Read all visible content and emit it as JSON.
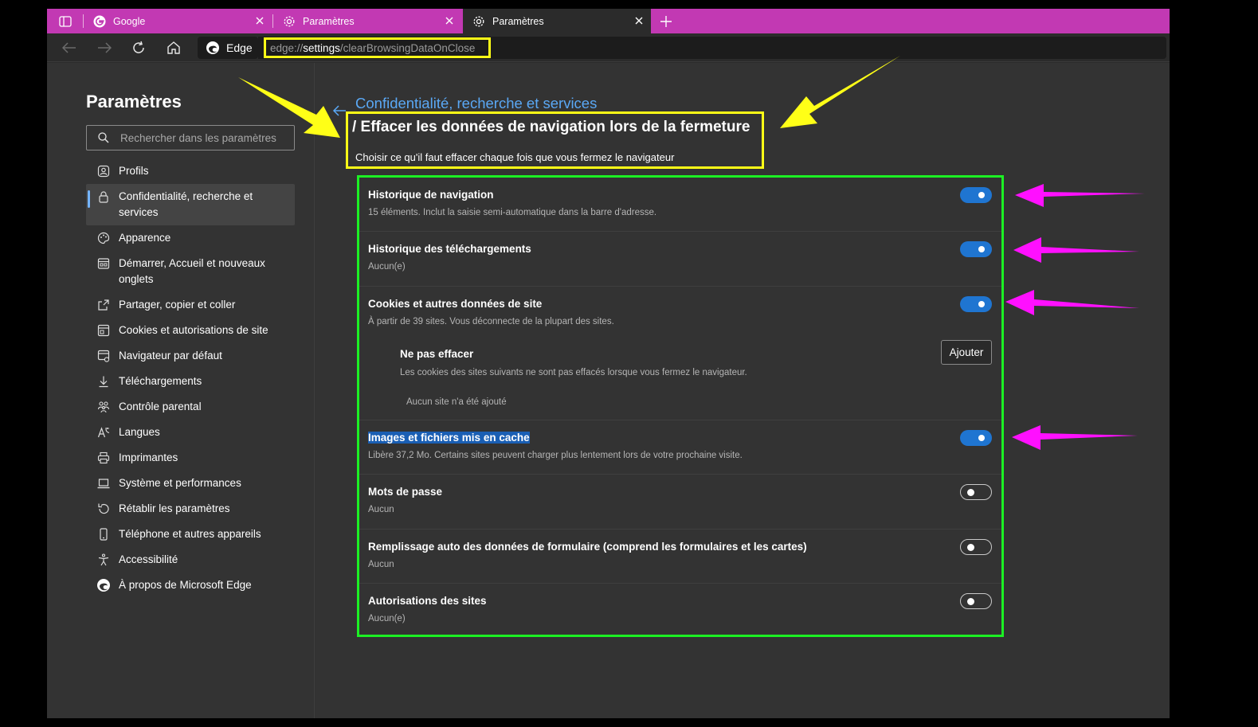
{
  "tabs": [
    {
      "title": "Google",
      "icon": "google-icon"
    },
    {
      "title": "Paramètres",
      "icon": "gear-icon"
    },
    {
      "title": "Paramètres",
      "icon": "gear-icon",
      "active": true
    }
  ],
  "toolbar": {
    "edge_label": "Edge",
    "url_scheme": "edge://",
    "url_host": "settings",
    "url_path": "/clearBrowsingDataOnClose"
  },
  "sidebar": {
    "title": "Paramètres",
    "search_placeholder": "Rechercher dans les paramètres",
    "items": [
      {
        "label": "Profils",
        "icon": "profile-icon"
      },
      {
        "label": "Confidentialité, recherche et services",
        "icon": "lock-icon",
        "selected": true
      },
      {
        "label": "Apparence",
        "icon": "palette-icon"
      },
      {
        "label": "Démarrer, Accueil et nouveaux onglets",
        "icon": "new-tab-icon"
      },
      {
        "label": "Partager, copier et coller",
        "icon": "share-icon"
      },
      {
        "label": "Cookies et autorisations de site",
        "icon": "cookies-icon"
      },
      {
        "label": "Navigateur par défaut",
        "icon": "default-browser-icon"
      },
      {
        "label": "Téléchargements",
        "icon": "download-icon"
      },
      {
        "label": "Contrôle parental",
        "icon": "family-icon"
      },
      {
        "label": "Langues",
        "icon": "language-icon"
      },
      {
        "label": "Imprimantes",
        "icon": "printer-icon"
      },
      {
        "label": "Système et performances",
        "icon": "laptop-icon"
      },
      {
        "label": "Rétablir les paramètres",
        "icon": "reset-icon"
      },
      {
        "label": "Téléphone et autres appareils",
        "icon": "phone-icon"
      },
      {
        "label": "Accessibilité",
        "icon": "accessibility-icon"
      },
      {
        "label": "À propos de Microsoft Edge",
        "icon": "edge-logo-icon"
      }
    ]
  },
  "content": {
    "breadcrumb": "Confidentialité, recherche et services",
    "title": "/ Effacer les données de navigation lors de la fermeture",
    "subtitle": "Choisir ce qu'il faut effacer chaque fois que vous fermez le navigateur",
    "rows": [
      {
        "title": "Historique de navigation",
        "desc": "15 éléments. Inclut la saisie semi-automatique dans la barre d'adresse.",
        "enabled": true
      },
      {
        "title": "Historique des téléchargements",
        "desc": "Aucun(e)",
        "enabled": true
      },
      {
        "title": "Cookies et autres données de site",
        "desc": "À partir de 39 sites. Vous déconnecte de la plupart des sites.",
        "enabled": true
      },
      {
        "title": "Images et fichiers mis en cache",
        "desc": "Libère 37,2 Mo. Certains sites peuvent charger plus lentement lors de votre prochaine visite.",
        "enabled": true,
        "highlighted": true
      },
      {
        "title": "Mots de passe",
        "desc": "Aucun",
        "enabled": false
      },
      {
        "title": "Remplissage auto des données de formulaire (comprend les formulaires et les cartes)",
        "desc": "Aucun",
        "enabled": false
      },
      {
        "title": "Autorisations des sites",
        "desc": "Aucun(e)",
        "enabled": false
      }
    ],
    "exceptions": {
      "title": "Ne pas effacer",
      "desc": "Les cookies des sites suivants ne sont pas effacés lorsque vous fermez le navigateur.",
      "empty": "Aucun site n'a été ajouté",
      "add_label": "Ajouter"
    }
  },
  "colors": {
    "tab_strip": "#c239b3",
    "annotation_yellow": "#ffff17",
    "annotation_green": "#1cf024",
    "annotation_magenta": "#ff10ff",
    "toggle_on": "#1f75d1",
    "link": "#5aa8f5"
  }
}
